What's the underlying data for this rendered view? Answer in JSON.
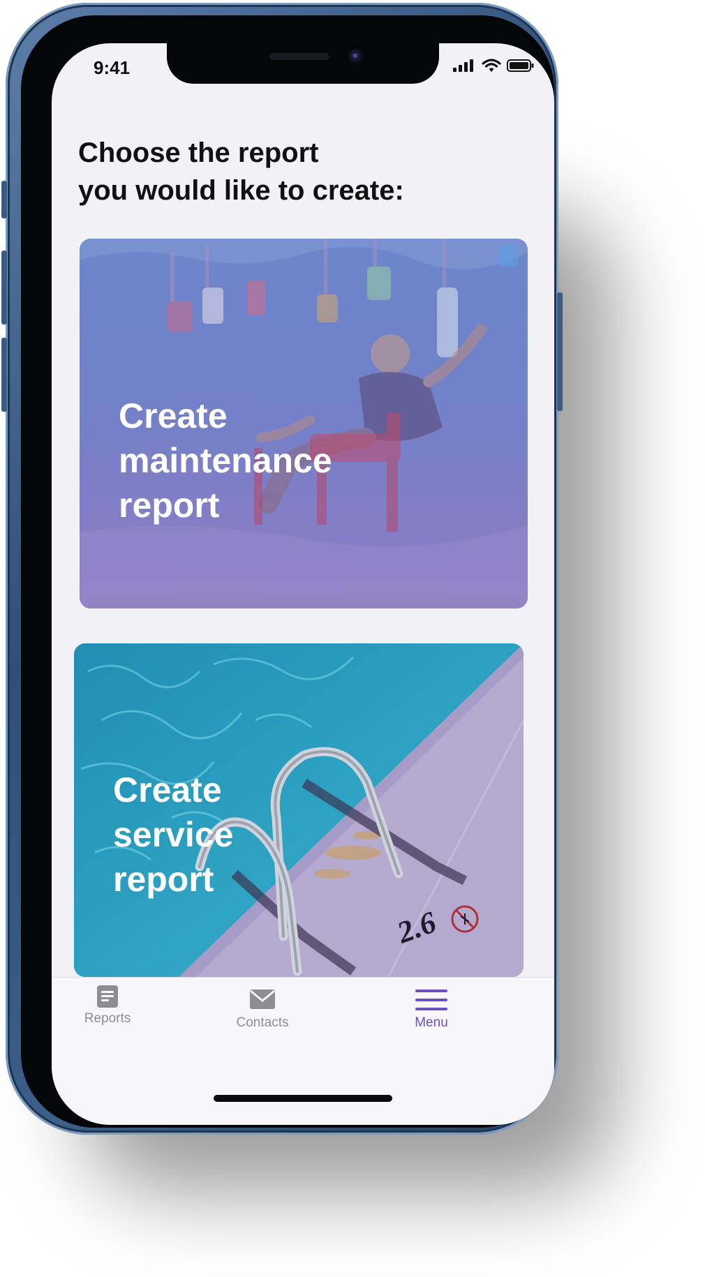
{
  "status_bar": {
    "time": "9:41"
  },
  "page": {
    "title_line1": "Choose the report",
    "title_line2": "you would like to create:"
  },
  "cards": [
    {
      "label_line1": "Create",
      "label_line2": "maintenance",
      "label_line3": "report"
    },
    {
      "label_line1": "Create",
      "label_line2": "service",
      "label_line3": "report"
    }
  ],
  "pool_signage": {
    "depth_text": "2.6",
    "no_diving_text": "NO DIVING"
  },
  "tab_bar": {
    "tabs": [
      {
        "label": "Reports",
        "icon": "document-icon",
        "active": false
      },
      {
        "label": "Contacts",
        "icon": "envelope-icon",
        "active": false
      },
      {
        "label": "Menu",
        "icon": "hamburger-menu-icon",
        "active": true
      }
    ]
  },
  "colors": {
    "accent": "#6a4fc0",
    "inactive_tab": "#8d8d93",
    "maintenance_overlay": "#7b84c9",
    "service_water": "#2d9dbd"
  }
}
